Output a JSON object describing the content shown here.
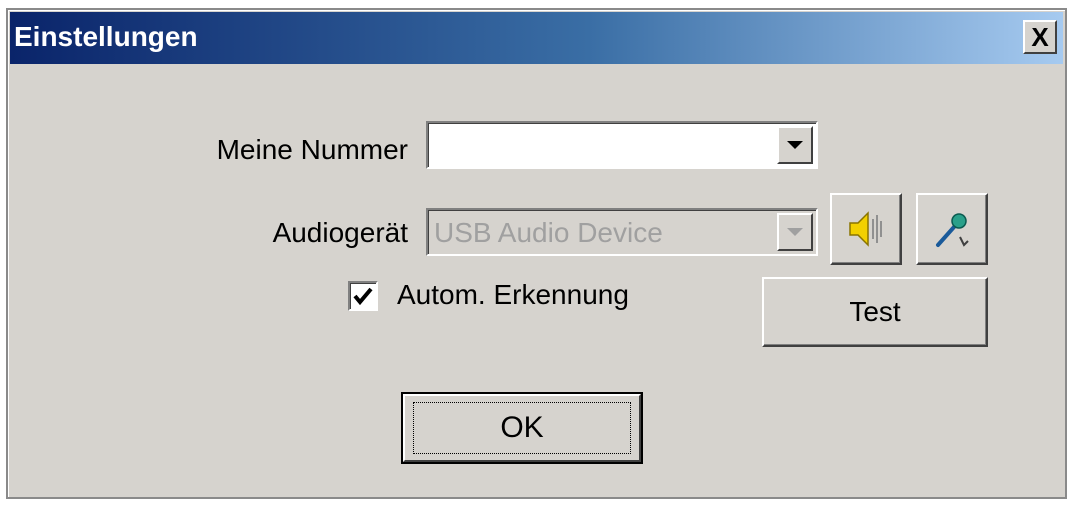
{
  "window": {
    "title": "Einstellungen",
    "close_label": "X"
  },
  "number": {
    "label": "Meine Nummer",
    "value": ""
  },
  "audio": {
    "label": "Audiogerät",
    "value": "USB Audio Device",
    "speaker_icon": "speaker-icon",
    "microphone_icon": "microphone-icon"
  },
  "auto_detect": {
    "label": "Autom. Erkennung",
    "checked": true
  },
  "test_button": {
    "label": "Test"
  },
  "ok_button": {
    "label": "OK"
  },
  "colors": {
    "titlebar_start": "#0a246a",
    "titlebar_end": "#a6caf0",
    "face": "#d6d3ce",
    "disabled_text": "#a0a0a0"
  }
}
